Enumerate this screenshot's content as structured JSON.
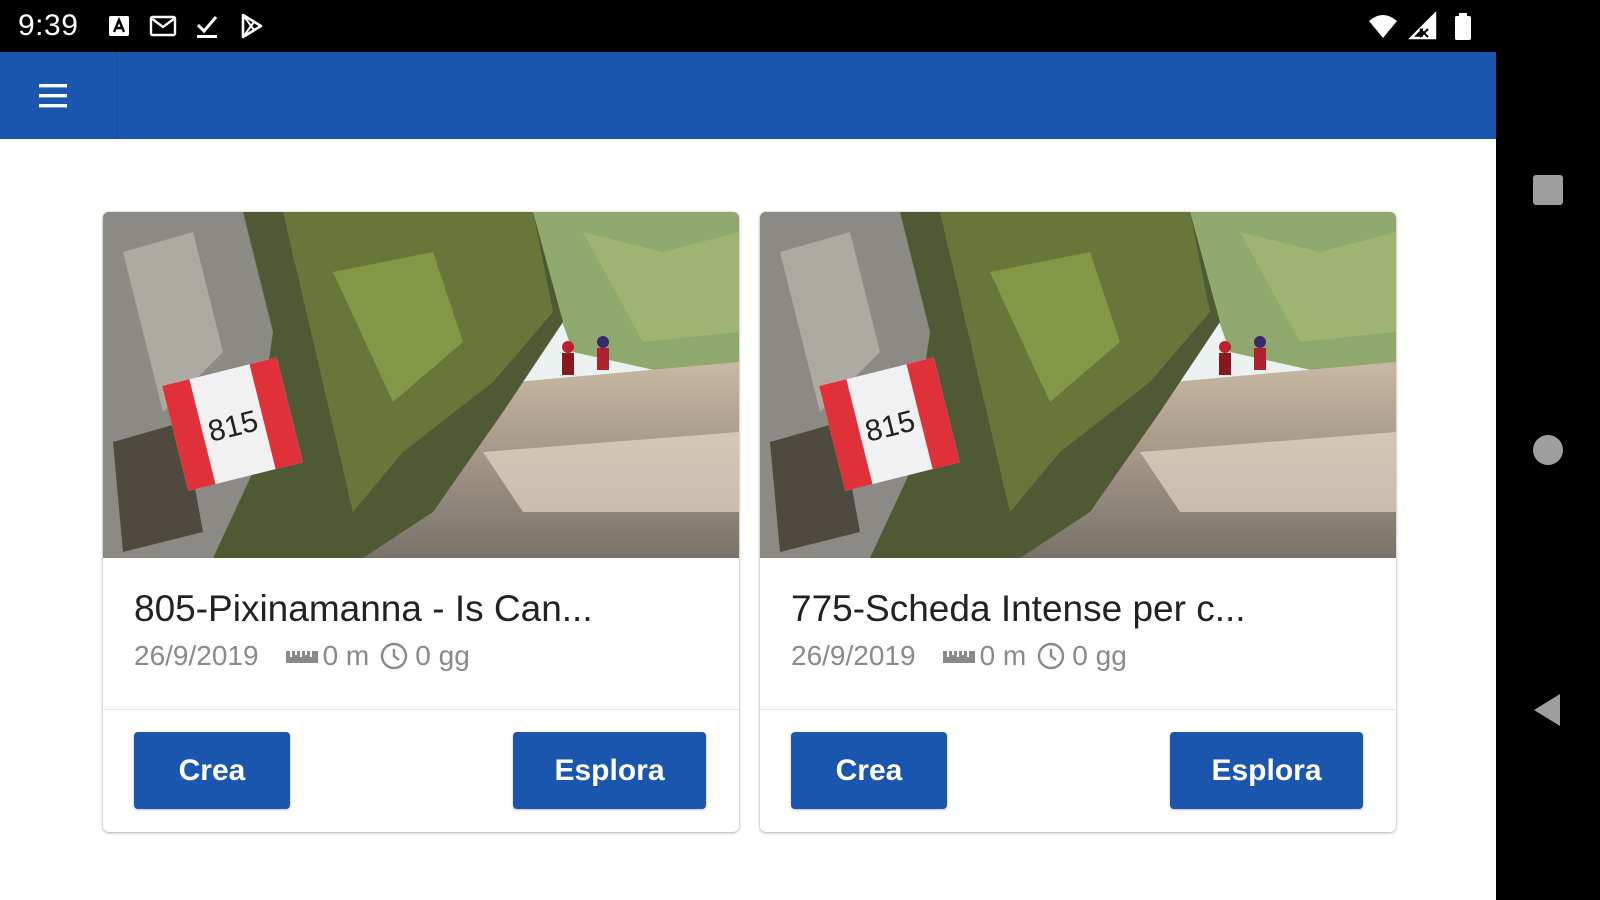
{
  "status_bar": {
    "time": "9:39",
    "left_icons": [
      "a-notification-icon",
      "gmail-icon",
      "download-done-icon",
      "play-store-icon"
    ],
    "right_icons": [
      "wifi-icon",
      "cell-signal-icon",
      "battery-icon"
    ]
  },
  "app_bar": {
    "menu_icon": "hamburger-menu-icon",
    "color": "#1a56ad"
  },
  "cards": [
    {
      "title": "805-Pixinamanna - Is Can...",
      "date": "26/9/2019",
      "distance": "0 m",
      "duration": "0 gg",
      "image": "trail-marker-815-photo",
      "create_label": "Crea",
      "explore_label": "Esplora"
    },
    {
      "title": "775-Scheda Intense per c...",
      "date": "26/9/2019",
      "distance": "0 m",
      "duration": "0 gg",
      "image": "trail-marker-815-photo",
      "create_label": "Crea",
      "explore_label": "Esplora"
    }
  ],
  "nav_bar": {
    "icons": [
      "recents-square-icon",
      "home-circle-icon",
      "back-triangle-icon"
    ]
  },
  "colors": {
    "primary": "#1a56ad",
    "meta_text": "#8a8a8a",
    "title_text": "#222222"
  }
}
